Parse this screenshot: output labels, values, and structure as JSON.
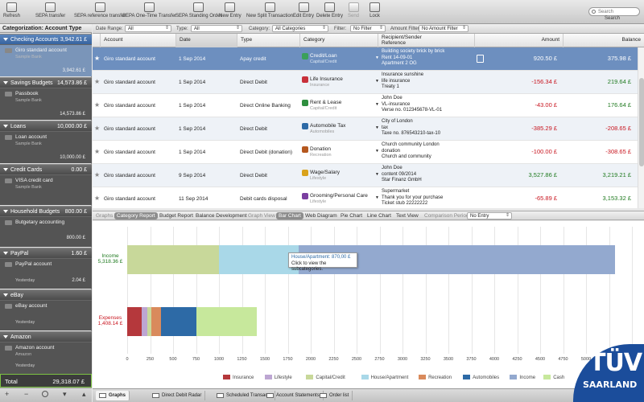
{
  "toolbar": {
    "buttons": [
      "Refresh",
      "SEPA transfer",
      "SEPA reference transfer",
      "SEPA One-Time Transfer",
      "SEPA Standing Order",
      "New Entry",
      "New Split Transaction",
      "Edit Entry",
      "Delete Entry",
      "Send",
      "Lock"
    ],
    "search_placeholder": "Search",
    "search_label": "Search"
  },
  "sidebar": {
    "header": "Categorization: Account Type",
    "groups": [
      {
        "name": "Checking Accounts",
        "amount": "3,942.61 £"
      },
      {
        "name": "Savings Budgets",
        "amount": "14,573.86 £"
      },
      {
        "name": "Loans",
        "amount": "10,000.00 £"
      },
      {
        "name": "Credit Cards",
        "amount": "0.00 £"
      },
      {
        "name": "Household Budgets",
        "amount": "800.00 £"
      },
      {
        "name": "PayPal",
        "amount": "1.60 £"
      },
      {
        "name": "eBay",
        "amount": ""
      },
      {
        "name": "Amazon",
        "amount": ""
      }
    ],
    "accounts": [
      {
        "name": "Giro standard account",
        "bank": "Sample Bank",
        "balance": "3,942.61 £",
        "date": ""
      },
      {
        "name": "Passbook",
        "bank": "Sample Bank",
        "balance": "14,573.86 £",
        "date": ""
      },
      {
        "name": "Loan account",
        "bank": "Sample Bank",
        "balance": "10,000.00 £",
        "date": ""
      },
      {
        "name": "VISA credit card",
        "bank": "Sample Bank",
        "balance": "",
        "date": ""
      },
      {
        "name": "Butgetary accounting",
        "bank": "",
        "balance": "800.00 £",
        "date": ""
      },
      {
        "name": "PayPal account",
        "bank": "",
        "balance": "2.04 £",
        "date": "Yesterday"
      },
      {
        "name": "eBay account",
        "bank": "",
        "balance": "",
        "date": "Yesterday"
      },
      {
        "name": "Amazon account",
        "bank": "Amazon",
        "balance": "",
        "date": "Yesterday"
      }
    ],
    "total_label": "Total",
    "total_amount": "29,318.07 £"
  },
  "filters": {
    "date_range_label": "Date Range:",
    "date_range": "All",
    "type_label": "Type:",
    "type": "All",
    "category_label": "Category:",
    "category": "All Categories",
    "filter_label": "Filter:",
    "filter": "No Filter",
    "amount_filter_label": "Amount Filter:",
    "amount_filter": "No Amount Filter"
  },
  "table": {
    "headers": {
      "account": "Account",
      "date": "Date",
      "type": "Type",
      "category": "Category",
      "recipient": "Recipient/Sender",
      "reference": "Reference",
      "amount": "Amount",
      "balance": "Balance"
    },
    "rows": [
      {
        "account": "Giro standard account",
        "date": "1 Sep 2014",
        "type": "Apay credit",
        "category": "Credit/Loan",
        "subcategory": "Capital/Credit",
        "r1": "Building society brick by brick",
        "r2": "Rent 14-09-01",
        "r3": "Apartment 2 OG",
        "amount": "920.50 £",
        "balance": "375.98 £"
      },
      {
        "account": "Giro standard account",
        "date": "1 Sep 2014",
        "type": "Direct Debit",
        "category": "Life Insurance",
        "subcategory": "Insurance",
        "r1": "Insurance sunshine",
        "r2": "life insurance",
        "r3": "Treaty 1",
        "amount": "-156.34 £",
        "balance": "219.64 £"
      },
      {
        "account": "Giro standard account",
        "date": "1 Sep 2014",
        "type": "Direct Online Banking",
        "category": "Rent & Lease",
        "subcategory": "Capital/Credit",
        "r1": "John Doe",
        "r2": "VL-insurance",
        "r3": "Verse no. 012345678-VL-01",
        "amount": "-43.00 £",
        "balance": "176.64 £"
      },
      {
        "account": "Giro standard account",
        "date": "1 Sep 2014",
        "type": "Direct Debit",
        "category": "Automobile Tax",
        "subcategory": "Automobiles",
        "r1": "City of London",
        "r2": "tax",
        "r3": "Taxe no. 876543210-tax-10",
        "amount": "-385.29 £",
        "balance": "-208.65 £"
      },
      {
        "account": "Giro standard account",
        "date": "1 Sep 2014",
        "type": "Direct Debit (donation)",
        "category": "Donation",
        "subcategory": "Recreation",
        "r1": "Church community London",
        "r2": "donation",
        "r3": "Church and community",
        "amount": "-100.00 £",
        "balance": "-308.65 £"
      },
      {
        "account": "Giro standard account",
        "date": "9 Sep 2014",
        "type": "Direct Debit",
        "category": "Wage/Salary",
        "subcategory": "Lifestyle",
        "r1": "John Doe",
        "r2": "content 09/2014",
        "r3": "Star Finanz GmbH",
        "amount": "3,527.86 £",
        "balance": "3,219.21 £"
      },
      {
        "account": "Giro standard account",
        "date": "11 Sep 2014",
        "type": "Debit cards disposal",
        "category": "Grooming/Personal Care",
        "subcategory": "Lifestyle",
        "r1": "Supermarket",
        "r2": "Thank you for your purchase",
        "r3": "Ticket stub 22222222",
        "amount": "-65.89 £",
        "balance": "3,153.32 £"
      }
    ]
  },
  "graph_toolbar": {
    "graphs": "Graphs",
    "category_report": "Category Report",
    "budget_report": "Budget Report",
    "balance_dev": "Balance Development",
    "graph_view": "Graph View",
    "bar_chart": "Bar Chart",
    "web_diagram": "Web Diagram",
    "pie_chart": "Pie Chart",
    "line_chart": "Line Chart",
    "text_view": "Text View",
    "comparison_period": "Comparison Period",
    "no_entry": "No Entry"
  },
  "chart_data": {
    "type": "bar",
    "orientation": "horizontal-stacked",
    "categories": [
      "Income",
      "Expenses"
    ],
    "totals": [
      "5,318.36 £",
      "1,408.14 £"
    ],
    "xticks": [
      0,
      250,
      500,
      750,
      1000,
      1250,
      1500,
      1750,
      2000,
      2250,
      2500,
      2750,
      3000,
      3250,
      3500,
      3750,
      4000,
      4250,
      4500,
      4750,
      5000,
      5250,
      5500
    ],
    "series": [
      {
        "name": "Insurance",
        "color": "#b5383c",
        "values": [
          0,
          156.34
        ]
      },
      {
        "name": "Lifestyle",
        "color": "#bda6d2",
        "values": [
          0,
          65.89
        ]
      },
      {
        "name": "Capital/Credit",
        "color": "#c8d89a",
        "values": [
          1000,
          43
        ]
      },
      {
        "name": "House/Apartment",
        "color": "#a9d8e8",
        "values": [
          870,
          0
        ]
      },
      {
        "name": "Recreation",
        "color": "#d98a5c",
        "values": [
          0,
          100
        ]
      },
      {
        "name": "Automobiles",
        "color": "#2d6aa6",
        "values": [
          0,
          385.29
        ]
      },
      {
        "name": "Income",
        "color": "#93a9cf",
        "values": [
          3448.36,
          0
        ]
      },
      {
        "name": "Cash",
        "color": "#c7e89c",
        "values": [
          0,
          657.62
        ]
      }
    ],
    "tooltip": {
      "title": "House/Apartment: 870,00 £",
      "text": "Click to view the subcategories."
    },
    "grid": true,
    "legend": "bottom",
    "xlim": [
      0,
      5500
    ]
  },
  "bottom_tabs": [
    "Graphs",
    "Direct Debit Radar",
    "Scheduled Transac...",
    "Account Statements",
    "Order list"
  ],
  "badge": {
    "line1": "TÜV",
    "line2": "SAARLAND"
  }
}
